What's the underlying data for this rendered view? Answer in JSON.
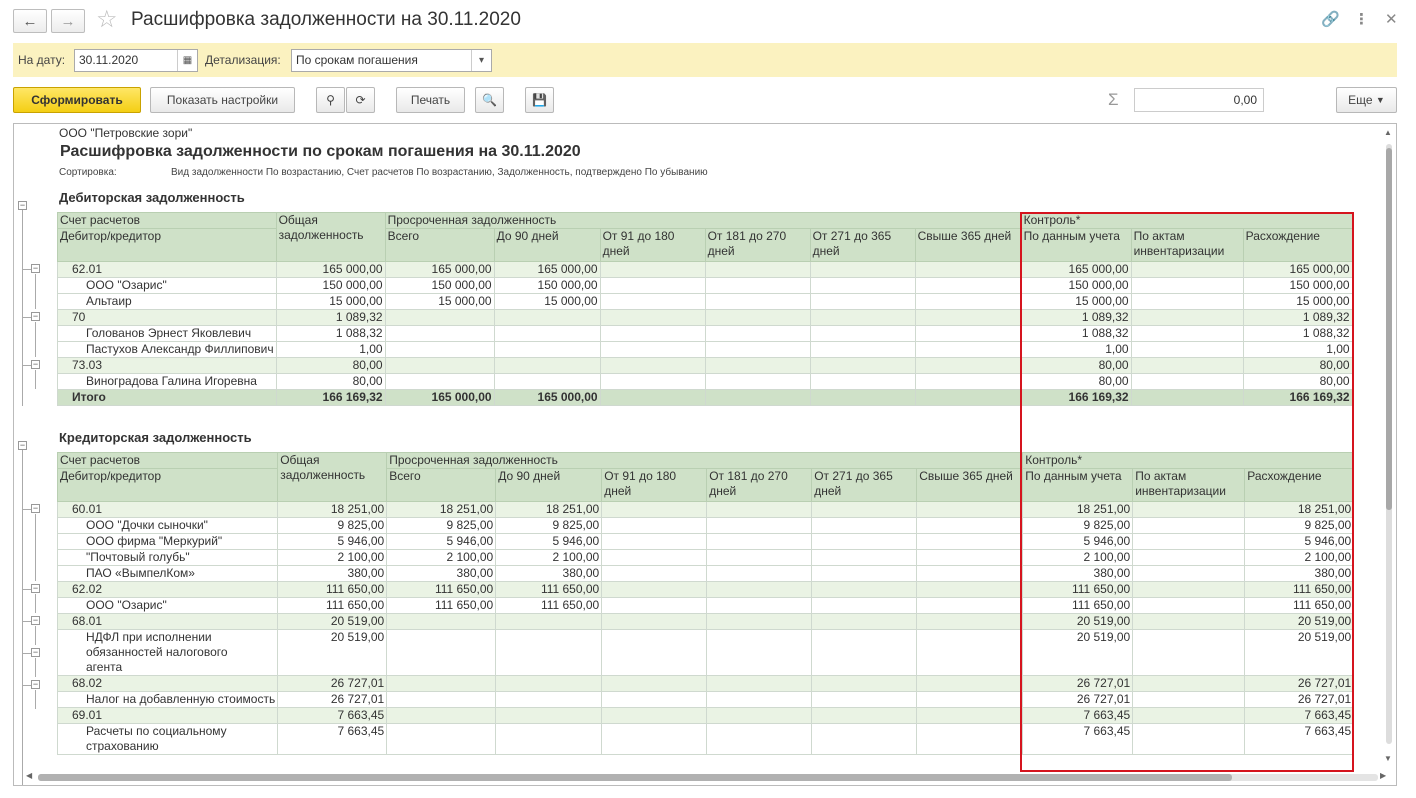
{
  "window": {
    "title": "Расшифровка задолженности на 30.11.2020"
  },
  "params": {
    "date_label": "На дату:",
    "date_value": "30.11.2020",
    "detail_label": "Детализация:",
    "detail_value": "По срокам погашения"
  },
  "toolbar": {
    "generate": "Сформировать",
    "settings": "Показать настройки",
    "print": "Печать",
    "sum_value": "0,00",
    "more": "Еще"
  },
  "report": {
    "org": "ООО \"Петровские зори\"",
    "title": "Расшифровка задолженности по срокам погашения на 30.11.2020",
    "sort_label": "Сортировка:",
    "sort_value": "Вид задолженности По возрастанию, Счет расчетов По возрастанию, Задолженность, подтверждено По убыванию",
    "headers": {
      "account": "Счет расчетов",
      "counterparty": "Дебитор/кредитор",
      "total": "Общая задолженность",
      "overdue": "Просроченная задолженность",
      "all": "Всего",
      "to90": "До 90 дней",
      "d91": "От 91 до 180 дней",
      "d181": "От 181 до 270 дней",
      "d271": "От 271 до 365 дней",
      "over365": "Свыше 365 дней",
      "control": "Контроль*",
      "accounting": "По данным учета",
      "inventory": "По актам инвентаризации",
      "diff": "Расхождение"
    },
    "debit": {
      "title": "Дебиторская задолженность",
      "rows": [
        {
          "name": "62.01",
          "acc": true,
          "v": [
            "165 000,00",
            "165 000,00",
            "165 000,00",
            "",
            "",
            "",
            "",
            "165 000,00",
            "",
            "165 000,00"
          ]
        },
        {
          "name": "ООО \"Озарис\"",
          "v": [
            "150 000,00",
            "150 000,00",
            "150 000,00",
            "",
            "",
            "",
            "",
            "150 000,00",
            "",
            "150 000,00"
          ]
        },
        {
          "name": "Альтаир",
          "v": [
            "15 000,00",
            "15 000,00",
            "15 000,00",
            "",
            "",
            "",
            "",
            "15 000,00",
            "",
            "15 000,00"
          ]
        },
        {
          "name": "70",
          "acc": true,
          "v": [
            "1 089,32",
            "",
            "",
            "",
            "",
            "",
            "",
            "1 089,32",
            "",
            "1 089,32"
          ]
        },
        {
          "name": "Голованов Эрнест Яковлевич",
          "v": [
            "1 088,32",
            "",
            "",
            "",
            "",
            "",
            "",
            "1 088,32",
            "",
            "1 088,32"
          ]
        },
        {
          "name": "Пастухов Александр Филлипович",
          "v": [
            "1,00",
            "",
            "",
            "",
            "",
            "",
            "",
            "1,00",
            "",
            "1,00"
          ]
        },
        {
          "name": "73.03",
          "acc": true,
          "v": [
            "80,00",
            "",
            "",
            "",
            "",
            "",
            "",
            "80,00",
            "",
            "80,00"
          ]
        },
        {
          "name": "Виноградова Галина Игоревна",
          "v": [
            "80,00",
            "",
            "",
            "",
            "",
            "",
            "",
            "80,00",
            "",
            "80,00"
          ]
        }
      ],
      "total": {
        "name": "Итого",
        "v": [
          "166 169,32",
          "165 000,00",
          "165 000,00",
          "",
          "",
          "",
          "",
          "166 169,32",
          "",
          "166 169,32"
        ]
      }
    },
    "credit": {
      "title": "Кредиторская задолженность",
      "rows": [
        {
          "name": "60.01",
          "acc": true,
          "v": [
            "18 251,00",
            "18 251,00",
            "18 251,00",
            "",
            "",
            "",
            "",
            "18 251,00",
            "",
            "18 251,00"
          ]
        },
        {
          "name": "ООО \"Дочки сыночки\"",
          "v": [
            "9 825,00",
            "9 825,00",
            "9 825,00",
            "",
            "",
            "",
            "",
            "9 825,00",
            "",
            "9 825,00"
          ]
        },
        {
          "name": "ООО фирма \"Меркурий\"",
          "v": [
            "5 946,00",
            "5 946,00",
            "5 946,00",
            "",
            "",
            "",
            "",
            "5 946,00",
            "",
            "5 946,00"
          ]
        },
        {
          "name": "\"Почтовый голубь\"",
          "v": [
            "2 100,00",
            "2 100,00",
            "2 100,00",
            "",
            "",
            "",
            "",
            "2 100,00",
            "",
            "2 100,00"
          ]
        },
        {
          "name": "ПАО «ВымпелКом»",
          "v": [
            "380,00",
            "380,00",
            "380,00",
            "",
            "",
            "",
            "",
            "380,00",
            "",
            "380,00"
          ]
        },
        {
          "name": "62.02",
          "acc": true,
          "v": [
            "111 650,00",
            "111 650,00",
            "111 650,00",
            "",
            "",
            "",
            "",
            "111 650,00",
            "",
            "111 650,00"
          ]
        },
        {
          "name": "ООО \"Озарис\"",
          "v": [
            "111 650,00",
            "111 650,00",
            "111 650,00",
            "",
            "",
            "",
            "",
            "111 650,00",
            "",
            "111 650,00"
          ]
        },
        {
          "name": "68.01",
          "acc": true,
          "v": [
            "20 519,00",
            "",
            "",
            "",
            "",
            "",
            "",
            "20 519,00",
            "",
            "20 519,00"
          ]
        },
        {
          "name": "НДФЛ при исполнении обязанностей налогового агента",
          "v": [
            "20 519,00",
            "",
            "",
            "",
            "",
            "",
            "",
            "20 519,00",
            "",
            "20 519,00"
          ]
        },
        {
          "name": "68.02",
          "acc": true,
          "v": [
            "26 727,01",
            "",
            "",
            "",
            "",
            "",
            "",
            "26 727,01",
            "",
            "26 727,01"
          ]
        },
        {
          "name": "Налог на добавленную стоимость",
          "v": [
            "26 727,01",
            "",
            "",
            "",
            "",
            "",
            "",
            "26 727,01",
            "",
            "26 727,01"
          ]
        },
        {
          "name": "69.01",
          "acc": true,
          "v": [
            "7 663,45",
            "",
            "",
            "",
            "",
            "",
            "",
            "7 663,45",
            "",
            "7 663,45"
          ]
        },
        {
          "name": "Расчеты по социальному страхованию",
          "v": [
            "7 663,45",
            "",
            "",
            "",
            "",
            "",
            "",
            "7 663,45",
            "",
            "7 663,45"
          ]
        }
      ]
    }
  }
}
